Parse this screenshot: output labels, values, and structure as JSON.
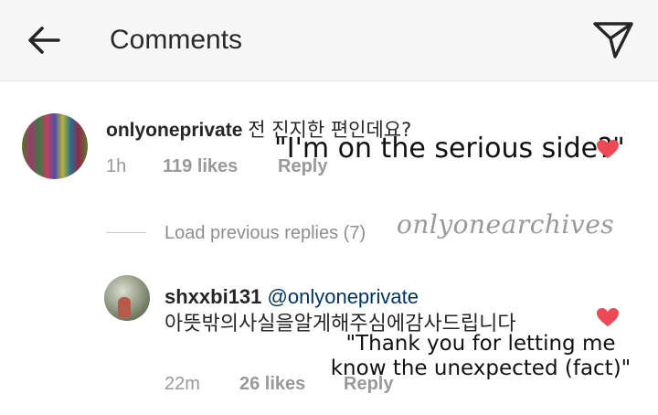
{
  "header": {
    "title": "Comments",
    "back_icon": "arrow-left-icon",
    "send_icon": "paper-plane-icon"
  },
  "comment": {
    "username": "onlyoneprivate",
    "text": "전 진지한 편인데요?",
    "overlay_translation": "\"I'm on the serious side?\"",
    "time": "1h",
    "likes": "119 likes",
    "reply_label": "Reply",
    "liked": true
  },
  "load_previous": "Load previous replies (7)",
  "watermark": "onlyonearchives",
  "reply": {
    "username": "shxxbi131",
    "mention": "@onlyoneprivate",
    "text": "아뜻밖의사실을알게해주심에감사드립니다",
    "overlay_translation": "\"Thank you for letting me know the unexpected (fact)\"",
    "time": "22m",
    "likes": "26 likes",
    "reply_label": "Reply",
    "liked": true
  },
  "colors": {
    "heart": "#ed4956",
    "mention": "#003569",
    "meta": "#999999",
    "header_bg": "#f7f7f7"
  }
}
